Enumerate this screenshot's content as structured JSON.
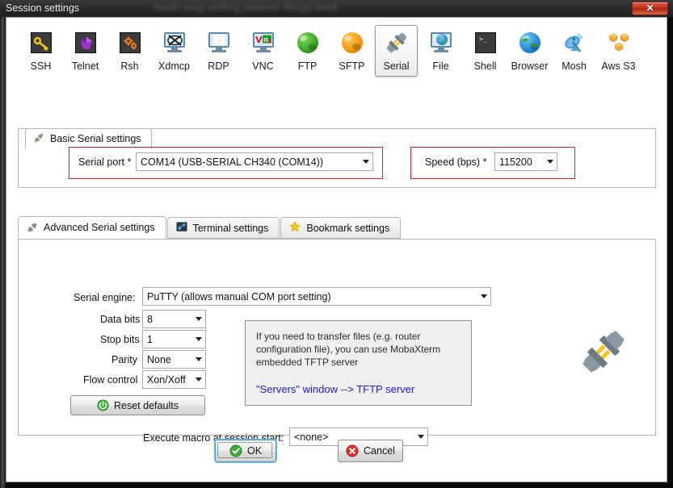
{
  "window": {
    "title": "Session settings",
    "ghost_text": "mosh sarg setting  reserve   things back",
    "close_label": "✕"
  },
  "session_types": [
    {
      "id": "ssh",
      "label": "SSH",
      "icon": "key-icon",
      "selected": false
    },
    {
      "id": "telnet",
      "label": "Telnet",
      "icon": "gem-icon",
      "selected": false
    },
    {
      "id": "rsh",
      "label": "Rsh",
      "icon": "gears-icon",
      "selected": false
    },
    {
      "id": "xdmcp",
      "label": "Xdmcp",
      "icon": "monitor-x-icon",
      "selected": false
    },
    {
      "id": "rdp",
      "label": "RDP",
      "icon": "monitor-windows-icon",
      "selected": false
    },
    {
      "id": "vnc",
      "label": "VNC",
      "icon": "monitor-vnc-icon",
      "selected": false
    },
    {
      "id": "ftp",
      "label": "FTP",
      "icon": "green-globe-icon",
      "selected": false
    },
    {
      "id": "sftp",
      "label": "SFTP",
      "icon": "orange-globe-icon",
      "selected": false
    },
    {
      "id": "serial",
      "label": "Serial",
      "icon": "serial-plug-icon",
      "selected": true
    },
    {
      "id": "file",
      "label": "File",
      "icon": "monitor-globe-icon",
      "selected": false
    },
    {
      "id": "shell",
      "label": "Shell",
      "icon": "terminal-icon",
      "selected": false
    },
    {
      "id": "browser",
      "label": "Browser",
      "icon": "blue-globe-icon",
      "selected": false
    },
    {
      "id": "mosh",
      "label": "Mosh",
      "icon": "satellite-dish-icon",
      "selected": false
    },
    {
      "id": "awss3",
      "label": "Aws S3",
      "icon": "aws-cubes-icon",
      "selected": false
    }
  ],
  "basic": {
    "tab_label": "Basic Serial settings",
    "tab_icon": "serial-plug-icon",
    "serial_port_label": "Serial port *",
    "serial_port_value": "COM14  (USB-SERIAL CH340 (COM14))",
    "speed_label": "Speed (bps) *",
    "speed_value": "115200"
  },
  "advanced": {
    "tabs": [
      {
        "id": "advanced-serial",
        "label": "Advanced Serial settings",
        "icon": "serial-plug-icon",
        "active": true
      },
      {
        "id": "terminal",
        "label": "Terminal settings",
        "icon": "terminal-settings-icon",
        "active": false
      },
      {
        "id": "bookmark",
        "label": "Bookmark settings",
        "icon": "star-icon",
        "active": false
      }
    ],
    "serial_engine_label": "Serial engine:",
    "serial_engine_value": "PuTTY   (allows manual COM port setting)",
    "data_bits_label": "Data bits",
    "data_bits_value": "8",
    "stop_bits_label": "Stop bits",
    "stop_bits_value": "1",
    "parity_label": "Parity",
    "parity_value": "None",
    "flow_control_label": "Flow control",
    "flow_control_value": "Xon/Xoff",
    "reset_defaults_label": "Reset defaults",
    "macro_label": "Execute macro at session start:",
    "macro_value": "<none>",
    "info_text": "If you need to transfer files (e.g. router configuration file), you can use MobaXterm embedded TFTP server",
    "info_link": "\"Servers\" window  -->  TFTP server"
  },
  "footer": {
    "ok_label": "OK",
    "cancel_label": "Cancel"
  },
  "colors": {
    "accent_red": "#e02020",
    "link_blue": "#2020c8",
    "ok_green": "#3cab3c",
    "cancel_red": "#e03030",
    "title_bar": "#2a2a2a"
  }
}
